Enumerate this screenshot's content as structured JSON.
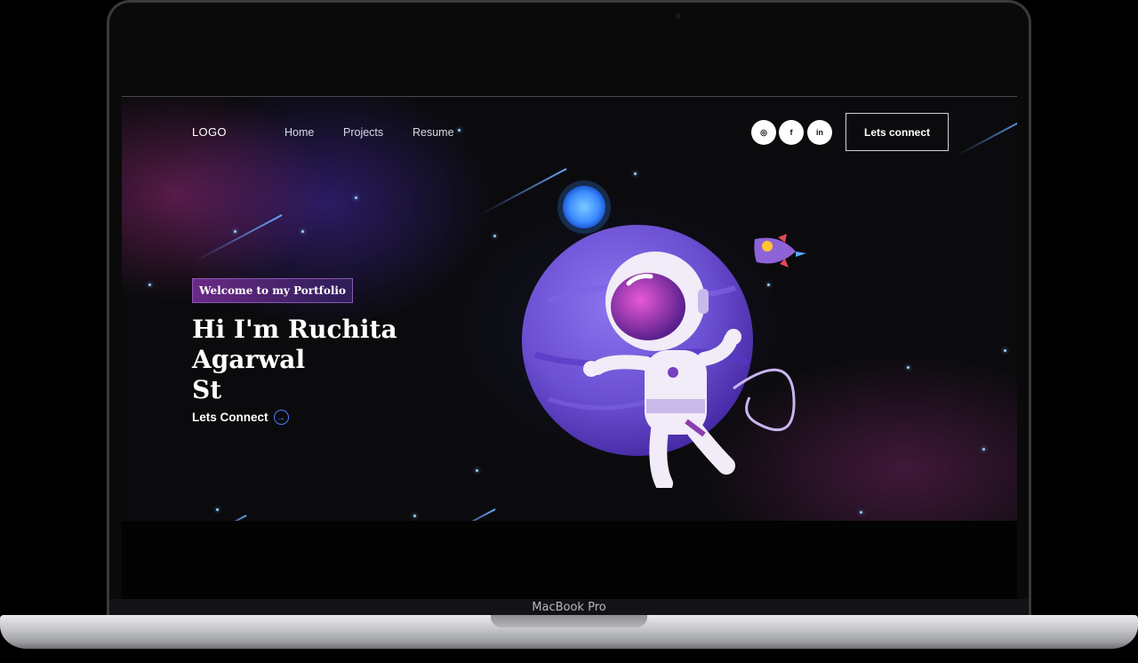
{
  "device": {
    "label": "MacBook Pro"
  },
  "nav": {
    "logo": "LOGO",
    "links": [
      "Home",
      "Projects",
      "Resume"
    ],
    "social": [
      {
        "icon": "instagram-icon",
        "glyph": "◎"
      },
      {
        "icon": "facebook-icon",
        "glyph": "f"
      },
      {
        "icon": "linkedin-icon",
        "glyph": "in"
      }
    ],
    "button_label": "Lets connect"
  },
  "hero": {
    "tagline": "Welcome to my Portfolio",
    "title_line1": "Hi I'm Ruchita Agarwal",
    "title_line2": "St",
    "cta_label": "Lets Connect",
    "cta_icon": "arrow-right-circle-icon",
    "illustration": "astronaut-planet-illustration"
  },
  "colors": {
    "accent": "#4f7dff",
    "tagline_bg": "#6a2a86",
    "planet": "#6a4fd1",
    "background": "#0b0b0e"
  }
}
